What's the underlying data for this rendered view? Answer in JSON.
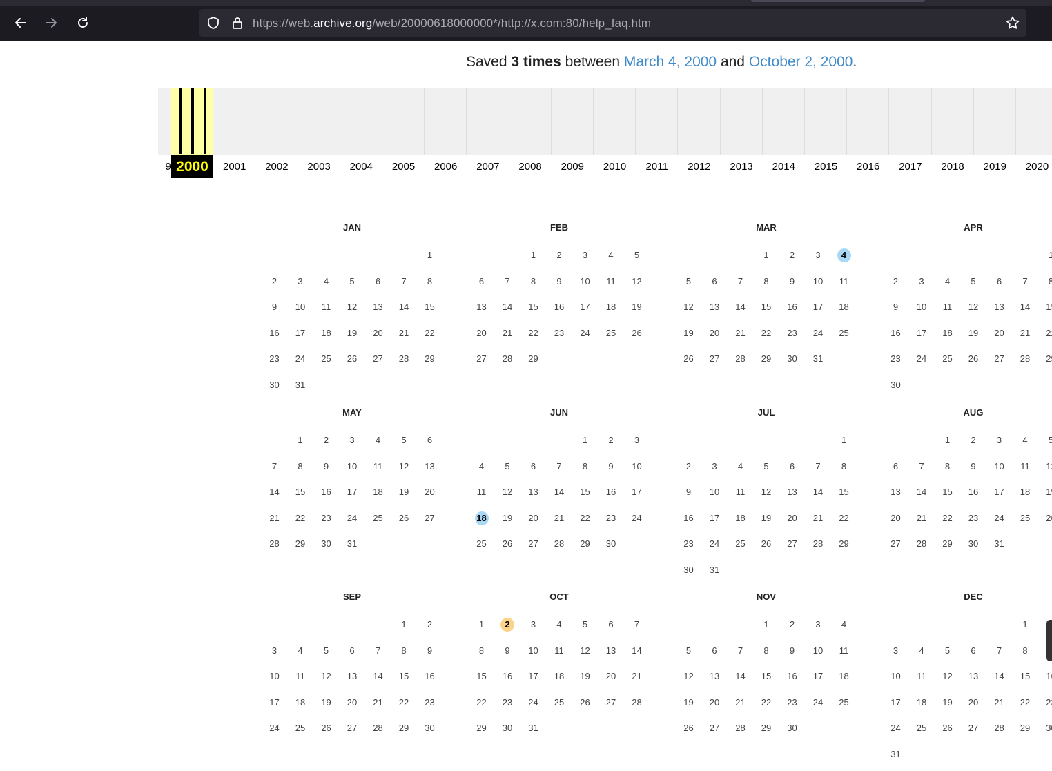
{
  "browser": {
    "url_prefix": "https://web.",
    "url_domain": "archive.org",
    "url_rest": "/web/20000618000000*/http://x.com:80/help_faq.htm"
  },
  "summary": {
    "saved": "Saved",
    "times": "3 times",
    "between": "between",
    "first_date": "March 4, 2000",
    "and": "and",
    "last_date": "October 2, 2000",
    "period": "."
  },
  "timeline": {
    "partial_year": "9",
    "years": [
      "2000",
      "2001",
      "2002",
      "2003",
      "2004",
      "2005",
      "2006",
      "2007",
      "2008",
      "2009",
      "2010",
      "2011",
      "2012",
      "2013",
      "2014",
      "2015",
      "2016",
      "2017",
      "2018",
      "2019",
      "2020"
    ],
    "selected_year": "2000",
    "captures_in_selected_year": 3
  },
  "calendar": {
    "year": 2000,
    "months": [
      {
        "name": "JAN",
        "start": 6,
        "days": 31
      },
      {
        "name": "FEB",
        "start": 2,
        "days": 29
      },
      {
        "name": "MAR",
        "start": 3,
        "days": 31
      },
      {
        "name": "APR",
        "start": 6,
        "days": 30
      },
      {
        "name": "MAY",
        "start": 1,
        "days": 31
      },
      {
        "name": "JUN",
        "start": 4,
        "days": 30
      },
      {
        "name": "JUL",
        "start": 6,
        "days": 31
      },
      {
        "name": "AUG",
        "start": 2,
        "days": 31
      },
      {
        "name": "SEP",
        "start": 5,
        "days": 30
      },
      {
        "name": "OCT",
        "start": 0,
        "days": 31
      },
      {
        "name": "NOV",
        "start": 3,
        "days": 30
      },
      {
        "name": "DEC",
        "start": 5,
        "days": 31
      }
    ],
    "captures": [
      {
        "month": "MAR",
        "day": 4,
        "color": "#a9d8f5"
      },
      {
        "month": "JUN",
        "day": 18,
        "color": "#a9d8f5"
      },
      {
        "month": "OCT",
        "day": 2,
        "color": "#f9d48a"
      }
    ]
  }
}
